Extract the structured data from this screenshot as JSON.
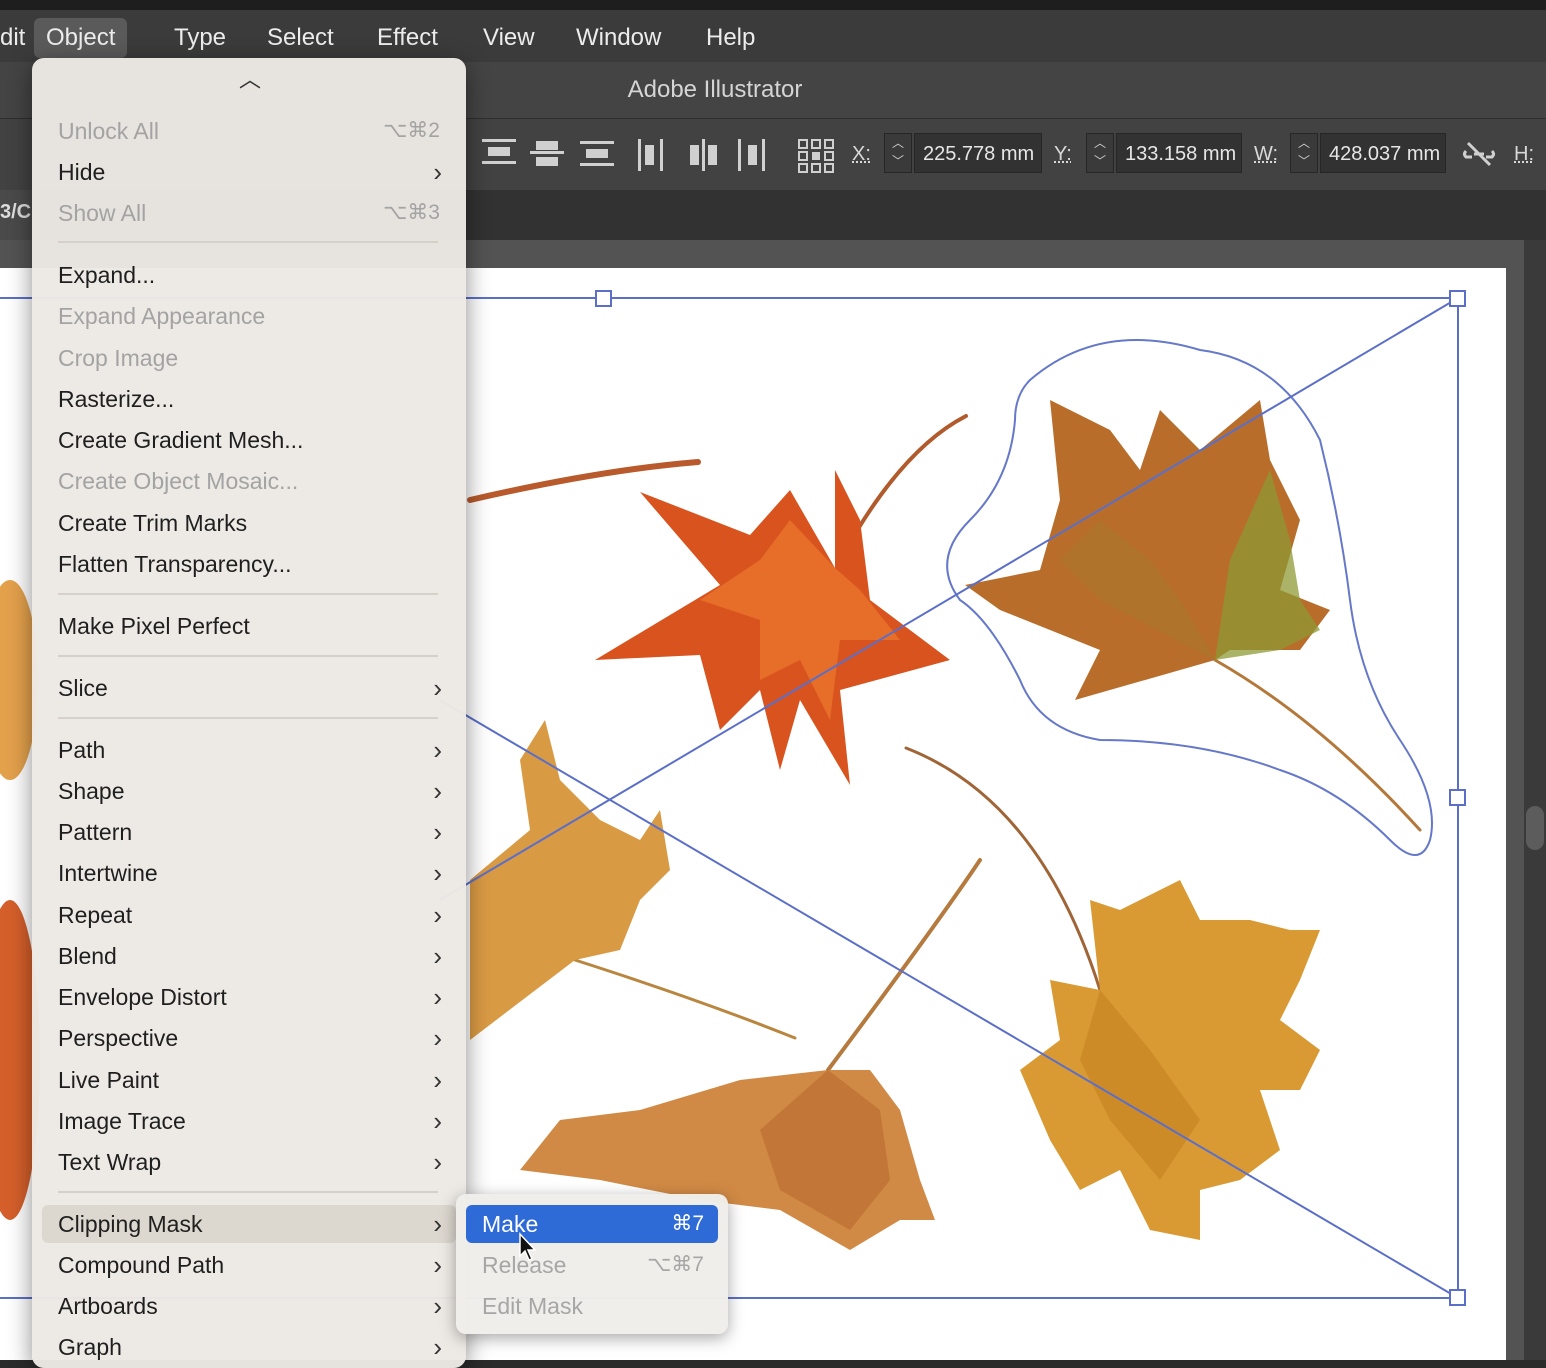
{
  "menubar": {
    "items": [
      {
        "label": "dit"
      },
      {
        "label": "Object"
      },
      {
        "label": "Type"
      },
      {
        "label": "Select"
      },
      {
        "label": "Effect"
      },
      {
        "label": "View"
      },
      {
        "label": "Window"
      },
      {
        "label": "Help"
      }
    ]
  },
  "titlebar": {
    "title": "Adobe Illustrator"
  },
  "controlbar": {
    "x_label": "X:",
    "x_value": "225.778 mm",
    "y_label": "Y:",
    "y_value": "133.158 mm",
    "w_label": "W:",
    "w_value": "428.037 mm",
    "h_label": "H:"
  },
  "tabbar": {
    "doc_tab": "3/C"
  },
  "object_menu": {
    "scroll_up_icon": "chevron-up-icon",
    "items": [
      {
        "label": "Unlock All",
        "shortcut": "⌥⌘2",
        "enabled": false
      },
      {
        "label": "Hide",
        "submenu": true,
        "enabled": true
      },
      {
        "label": "Show All",
        "shortcut": "⌥⌘3",
        "enabled": false
      },
      {
        "label": "Expand...",
        "enabled": true
      },
      {
        "label": "Expand Appearance",
        "enabled": false
      },
      {
        "label": "Crop Image",
        "enabled": false
      },
      {
        "label": "Rasterize...",
        "enabled": true
      },
      {
        "label": "Create Gradient Mesh...",
        "enabled": true
      },
      {
        "label": "Create Object Mosaic...",
        "enabled": false
      },
      {
        "label": "Create Trim Marks",
        "enabled": true
      },
      {
        "label": "Flatten Transparency...",
        "enabled": true
      },
      {
        "label": "Make Pixel Perfect",
        "enabled": true
      },
      {
        "label": "Slice",
        "submenu": true,
        "enabled": true
      },
      {
        "label": "Path",
        "submenu": true,
        "enabled": true
      },
      {
        "label": "Shape",
        "submenu": true,
        "enabled": true
      },
      {
        "label": "Pattern",
        "submenu": true,
        "enabled": true
      },
      {
        "label": "Intertwine",
        "submenu": true,
        "enabled": true
      },
      {
        "label": "Repeat",
        "submenu": true,
        "enabled": true
      },
      {
        "label": "Blend",
        "submenu": true,
        "enabled": true
      },
      {
        "label": "Envelope Distort",
        "submenu": true,
        "enabled": true
      },
      {
        "label": "Perspective",
        "submenu": true,
        "enabled": true
      },
      {
        "label": "Live Paint",
        "submenu": true,
        "enabled": true
      },
      {
        "label": "Image Trace",
        "submenu": true,
        "enabled": true
      },
      {
        "label": "Text Wrap",
        "submenu": true,
        "enabled": true
      },
      {
        "label": "Clipping Mask",
        "submenu": true,
        "enabled": true,
        "highlighted": true
      },
      {
        "label": "Compound Path",
        "submenu": true,
        "enabled": true
      },
      {
        "label": "Artboards",
        "submenu": true,
        "enabled": true
      },
      {
        "label": "Graph",
        "submenu": true,
        "enabled": true
      }
    ]
  },
  "clipping_submenu": {
    "items": [
      {
        "label": "Make",
        "shortcut": "⌘7",
        "enabled": true,
        "selected": true
      },
      {
        "label": "Release",
        "shortcut": "⌥⌘7",
        "enabled": false
      },
      {
        "label": "Edit Mask",
        "enabled": false
      }
    ]
  },
  "colors": {
    "selection": "#5b6fc9",
    "menu_highlight": "#2f6bd6",
    "leaf_orange": "#d9531e",
    "leaf_gold": "#d99a34",
    "leaf_green": "#8e9a34"
  }
}
